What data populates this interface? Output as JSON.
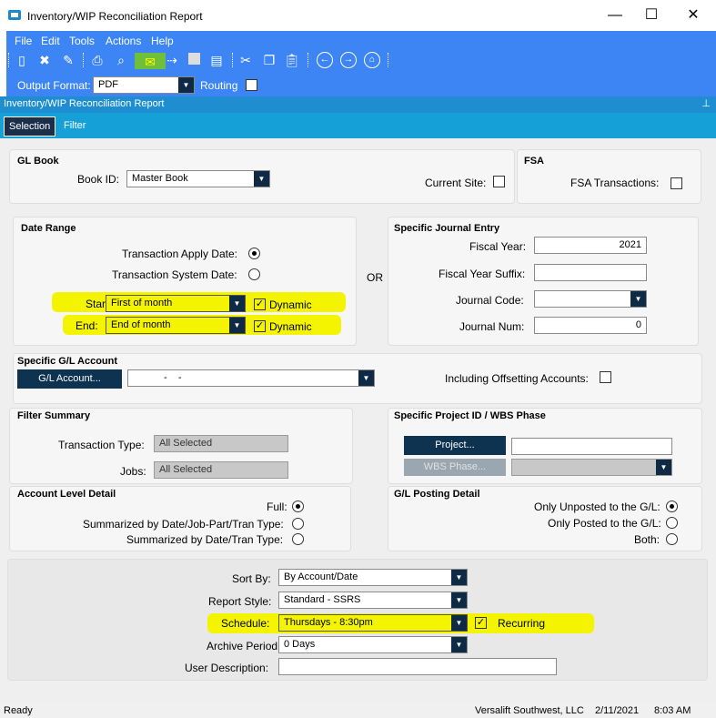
{
  "window": {
    "title": "Inventory/WIP Reconciliation Report"
  },
  "menu": [
    "File",
    "Edit",
    "Tools",
    "Actions",
    "Help"
  ],
  "output": {
    "label": "Output Format:",
    "value": "PDF",
    "routing_label": "Routing"
  },
  "panel_title": "Inventory/WIP Reconciliation Report",
  "tabs": [
    "Selection",
    "Filter"
  ],
  "gl_book": {
    "header": "GL Book",
    "book_label": "Book ID:",
    "book_value": "Master Book",
    "current_site_label": "Current Site:"
  },
  "fsa": {
    "header": "FSA",
    "transactions_label": "FSA Transactions:"
  },
  "date_range": {
    "header": "Date Range",
    "apply_label": "Transaction Apply Date:",
    "system_label": "Transaction System Date:",
    "start_label": "Start:",
    "start_value": "First of month",
    "end_label": "End:",
    "end_value": "End of month",
    "dynamic_label": "Dynamic",
    "or_label": "OR"
  },
  "journal": {
    "header": "Specific Journal Entry",
    "fiscal_year_label": "Fiscal Year:",
    "fiscal_year_value": "2021",
    "suffix_label": "Fiscal Year Suffix:",
    "code_label": "Journal Code:",
    "num_label": "Journal Num:",
    "num_value": "0"
  },
  "gl_account": {
    "header": "Specific G/L Account",
    "button": "G/L Account...",
    "value": "-    -",
    "offset_label": "Including Offsetting Accounts:"
  },
  "filter_summary": {
    "header": "Filter Summary",
    "type_label": "Transaction Type:",
    "type_value": "All Selected",
    "jobs_label": "Jobs:",
    "jobs_value": "All Selected"
  },
  "project": {
    "header": "Specific Project ID / WBS Phase",
    "project_button": "Project...",
    "wbs_button": "WBS Phase..."
  },
  "account_level": {
    "header": "Account Level Detail",
    "full": "Full:",
    "sum1": "Summarized by Date/Job-Part/Tran Type:",
    "sum2": "Summarized by Date/Tran Type:"
  },
  "posting": {
    "header": "G/L Posting Detail",
    "unposted": "Only Unposted to the G/L:",
    "posted": "Only Posted to the G/L:",
    "both": "Both:"
  },
  "bottom": {
    "sort_label": "Sort By:",
    "sort_value": "By Account/Date",
    "style_label": "Report Style:",
    "style_value": "Standard - SSRS",
    "schedule_label": "Schedule:",
    "schedule_value": "Thursdays - 8:30pm",
    "recurring_label": "Recurring",
    "archive_label": "Archive Period:",
    "archive_value": "0 Days",
    "desc_label": "User Description:"
  },
  "status": {
    "left": "Ready",
    "company": "Versalift Southwest, LLC",
    "date": "2/11/2021",
    "time": "8:03 AM"
  },
  "colors": {
    "toolbar": "#3d85f5",
    "tab_strip": "#15a0d8",
    "highlight": "#f4f400",
    "button": "#0e3350"
  }
}
